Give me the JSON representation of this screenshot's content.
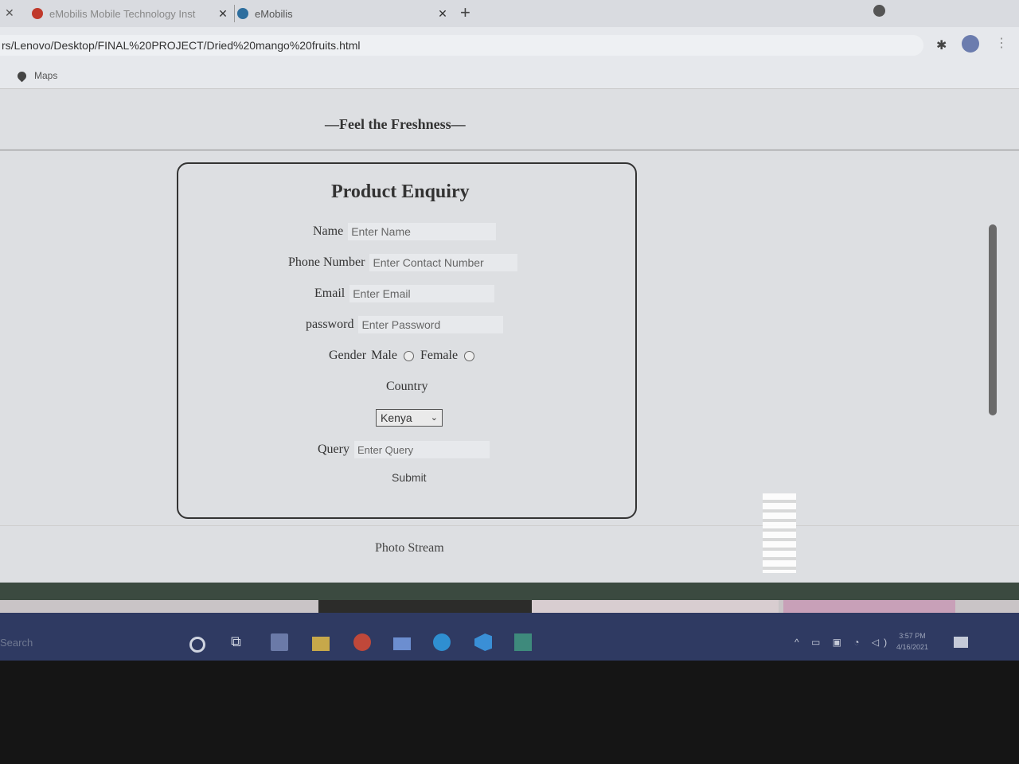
{
  "browser": {
    "tabs": [
      {
        "title": "eMobilis Mobile Technology Inst",
        "close": "✕"
      },
      {
        "title": "eMobilis",
        "close": "✕"
      }
    ],
    "new_tab": "+",
    "url": "rs/Lenovo/Desktop/FINAL%20PROJECT/Dried%20mango%20fruits.html",
    "bookmarks": [
      {
        "label": "Maps",
        "icon": "map-pin-icon"
      }
    ]
  },
  "page": {
    "tagline": "—Feel the Freshness—",
    "form": {
      "title": "Product Enquiry",
      "name_label": "Name",
      "name_placeholder": "Enter Name",
      "phone_label": "Phone Number",
      "phone_placeholder": "Enter Contact Number",
      "email_label": "Email",
      "email_placeholder": "Enter Email",
      "password_label": "password",
      "password_placeholder": "Enter Password",
      "gender_label": "Gender",
      "gender_male": "Male",
      "gender_female": "Female",
      "country_label": "Country",
      "country_value": "Kenya",
      "query_label": "Query",
      "query_placeholder": "Enter Query",
      "submit_label": "Submit"
    },
    "photo_stream": "Photo Stream"
  },
  "taskbar": {
    "search_text": "Search",
    "clock_time": "3:57 PM",
    "clock_date": "4/16/2021"
  },
  "colors": {
    "page_bg": "#dddfe2",
    "taskbar_bg": "#2f3a62",
    "text": "#333333"
  }
}
